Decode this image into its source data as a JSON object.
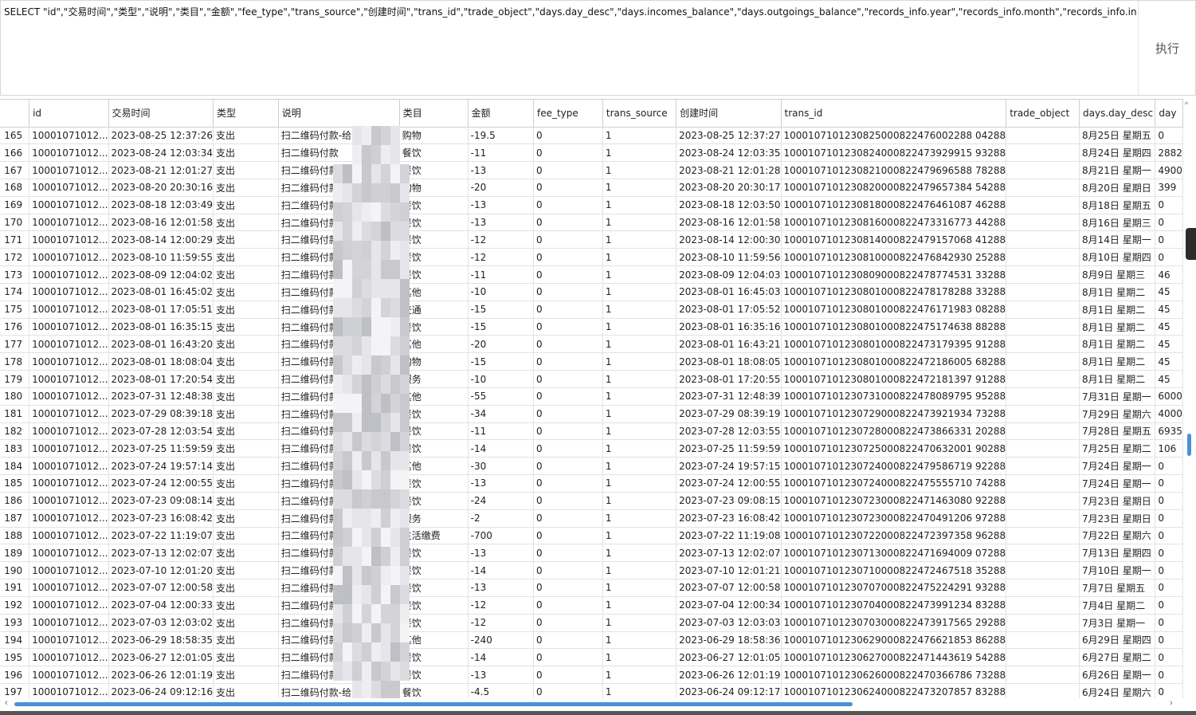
{
  "sql": {
    "query": "SELECT \"id\",\"交易时间\",\"类型\",\"说明\",\"类目\",\"金额\",\"fee_type\",\"trans_source\",\"创建时间\",\"trans_id\",\"trade_object\",\"days.day_desc\",\"days.incomes_balance\",\"days.outgoings_balance\",\"records_info.year\",\"records_info.month\",\"records_info.incomes_balance\",\"records_",
    "execute_label": "执行"
  },
  "table": {
    "columns": [
      "",
      "id",
      "交易时间",
      "类型",
      "说明",
      "类目",
      "金额",
      "fee_type",
      "trans_source",
      "创建时间",
      "trans_id",
      "trade_object",
      "days.day_desc",
      "day"
    ],
    "rows": [
      [
        "165",
        "10001071012...",
        "2023-08-25 12:37:26",
        "支出",
        "扫二维码付款-给",
        "购物",
        "-19.5",
        "0",
        "1",
        "2023-08-25 12:37:27",
        "1000107101230825000822476002288 04288",
        "",
        "8月25日 星期五",
        "0"
      ],
      [
        "166",
        "10001071012...",
        "2023-08-24 12:03:34",
        "支出",
        "扫二维码付款",
        "餐饮",
        "-11",
        "0",
        "1",
        "2023-08-24 12:03:35",
        "1000107101230824000822473929915 93288",
        "",
        "8月24日 星期四",
        "2882"
      ],
      [
        "167",
        "10001071012...",
        "2023-08-21 12:01:27",
        "支出",
        "扫二维码付款",
        "餐饮",
        "-13",
        "0",
        "1",
        "2023-08-21 12:01:28",
        "1000107101230821000822479696588 78288",
        "",
        "8月21日 星期一",
        "4900"
      ],
      [
        "168",
        "10001071012...",
        "2023-08-20 20:30:16",
        "支出",
        "扫二维码付款-给",
        "购物",
        "-20",
        "0",
        "1",
        "2023-08-20 20:30:17",
        "1000107101230820000822479657384 54288",
        "",
        "8月20日 星期日",
        "399"
      ],
      [
        "169",
        "10001071012...",
        "2023-08-18 12:03:49",
        "支出",
        "扫二维码付款-给",
        "餐饮",
        "-13",
        "0",
        "1",
        "2023-08-18 12:03:50",
        "1000107101230818000822476461087 46288",
        "",
        "8月18日 星期五",
        "0"
      ],
      [
        "170",
        "10001071012...",
        "2023-08-16 12:01:58",
        "支出",
        "扫二维码付款-",
        "餐饮",
        "-13",
        "0",
        "1",
        "2023-08-16 12:01:58",
        "1000107101230816000822473316773 44288",
        "",
        "8月16日 星期三",
        "0"
      ],
      [
        "171",
        "10001071012...",
        "2023-08-14 12:00:29",
        "支出",
        "扫二维码付款-",
        "餐饮",
        "-12",
        "0",
        "1",
        "2023-08-14 12:00:30",
        "1000107101230814000822479157068 41288",
        "",
        "8月14日 星期一",
        "0"
      ],
      [
        "172",
        "10001071012...",
        "2023-08-10 11:59:55",
        "支出",
        "扫二维码付款-",
        "餐饮",
        "-12",
        "0",
        "1",
        "2023-08-10 11:59:56",
        "1000107101230810000822476842930 25288",
        "",
        "8月10日 星期四",
        "0"
      ],
      [
        "173",
        "10001071012...",
        "2023-08-09 12:04:02",
        "支出",
        "扫二维码付款-",
        "餐饮",
        "-11",
        "0",
        "1",
        "2023-08-09 12:04:03",
        "1000107101230809000822478774531 33288",
        "",
        "8月9日 星期三",
        "46"
      ],
      [
        "174",
        "10001071012...",
        "2023-08-01 16:45:02",
        "支出",
        "扫二维码付款-给",
        "其他",
        "-10",
        "0",
        "1",
        "2023-08-01 16:45:03",
        "1000107101230801000822478178288 33288",
        "",
        "8月1日 星期二",
        "45"
      ],
      [
        "175",
        "10001071012...",
        "2023-08-01 17:05:51",
        "支出",
        "扫二维码付款-给",
        "交通",
        "-15",
        "0",
        "1",
        "2023-08-01 17:05:52",
        "1000107101230801000822476171983 08288",
        "",
        "8月1日 星期二",
        "45"
      ],
      [
        "176",
        "10001071012...",
        "2023-08-01 16:35:15",
        "支出",
        "扫二维码付款-给",
        "餐饮",
        "-15",
        "0",
        "1",
        "2023-08-01 16:35:16",
        "1000107101230801000822475174638 88288",
        "",
        "8月1日 星期二",
        "45"
      ],
      [
        "177",
        "10001071012...",
        "2023-08-01 16:43:20",
        "支出",
        "扫二维码付款-给",
        "其他",
        "-20",
        "0",
        "1",
        "2023-08-01 16:43:21",
        "1000107101230801000822473179395 91288",
        "",
        "8月1日 星期二",
        "45"
      ],
      [
        "178",
        "10001071012...",
        "2023-08-01 18:08:04",
        "支出",
        "扫二维码付款-给",
        "购物",
        "-15",
        "0",
        "1",
        "2023-08-01 18:08:05",
        "1000107101230801000822472186005 68288",
        "",
        "8月1日 星期二",
        "45"
      ],
      [
        "179",
        "10001071012...",
        "2023-08-01 17:20:54",
        "支出",
        "扫二维码付款",
        "服务",
        "-10",
        "0",
        "1",
        "2023-08-01 17:20:55",
        "1000107101230801000822472181397 91288",
        "",
        "8月1日 星期二",
        "45"
      ],
      [
        "180",
        "10001071012...",
        "2023-07-31 12:48:38",
        "支出",
        "扫二维码付款",
        "其他",
        "-55",
        "0",
        "1",
        "2023-07-31 12:48:39",
        "1000107101230731000822478089795 95288",
        "",
        "7月31日 星期一",
        "6000"
      ],
      [
        "181",
        "10001071012...",
        "2023-07-29 08:39:18",
        "支出",
        "扫二维码付款",
        "餐饮",
        "-34",
        "0",
        "1",
        "2023-07-29 08:39:19",
        "1000107101230729000822473921934 73288",
        "",
        "7月29日 星期六",
        "4000"
      ],
      [
        "182",
        "10001071012...",
        "2023-07-28 12:03:54",
        "支出",
        "扫二维码付款",
        "餐饮",
        "-11",
        "0",
        "1",
        "2023-07-28 12:03:55",
        "1000107101230728000822473866331 20288",
        "",
        "7月28日 星期五",
        "6935"
      ],
      [
        "183",
        "10001071012...",
        "2023-07-25 11:59:59",
        "支出",
        "扫二维码付款-",
        "餐饮",
        "-14",
        "0",
        "1",
        "2023-07-25 11:59:59",
        "1000107101230725000822470632001 90288",
        "",
        "7月25日 星期二",
        "106"
      ],
      [
        "184",
        "10001071012...",
        "2023-07-24 19:57:14",
        "支出",
        "扫二维码付款-",
        "其他",
        "-30",
        "0",
        "1",
        "2023-07-24 19:57:15",
        "1000107101230724000822479586719 92288",
        "",
        "7月24日 星期一",
        "0"
      ],
      [
        "185",
        "10001071012...",
        "2023-07-24 12:00:55",
        "支出",
        "扫二维码付款-",
        "餐饮",
        "-13",
        "0",
        "1",
        "2023-07-24 12:00:55",
        "1000107101230724000822475555710 74288",
        "",
        "7月24日 星期一",
        "0"
      ],
      [
        "186",
        "10001071012...",
        "2023-07-23 09:08:14",
        "支出",
        "扫二维码付款-",
        "餐饮",
        "-24",
        "0",
        "1",
        "2023-07-23 09:08:15",
        "1000107101230723000822471463080 92288",
        "",
        "7月23日 星期日",
        "0"
      ],
      [
        "187",
        "10001071012...",
        "2023-07-23 16:08:42",
        "支出",
        "扫二维码付款-",
        "服务",
        "-2",
        "0",
        "1",
        "2023-07-23 16:08:42",
        "1000107101230723000822470491206 97288",
        "",
        "7月23日 星期日",
        "0"
      ],
      [
        "188",
        "10001071012...",
        "2023-07-22 11:19:07",
        "支出",
        "扫二维码付款-",
        "生活缴费",
        "-700",
        "0",
        "1",
        "2023-07-22 11:19:08",
        "1000107101230722000822472397358 96288",
        "",
        "7月22日 星期六",
        "0"
      ],
      [
        "189",
        "10001071012...",
        "2023-07-13 12:02:07",
        "支出",
        "扫二维码付款-",
        "餐饮",
        "-13",
        "0",
        "1",
        "2023-07-13 12:02:07",
        "1000107101230713000822471694009 07288",
        "",
        "7月13日 星期四",
        "0"
      ],
      [
        "190",
        "10001071012...",
        "2023-07-10 12:01:20",
        "支出",
        "扫二维码付款-",
        "餐饮",
        "-14",
        "0",
        "1",
        "2023-07-10 12:01:21",
        "1000107101230710000822472467518 35288",
        "",
        "7月10日 星期一",
        "0"
      ],
      [
        "191",
        "10001071012...",
        "2023-07-07 12:00:58",
        "支出",
        "扫二维码付款-",
        "餐饮",
        "-13",
        "0",
        "1",
        "2023-07-07 12:00:58",
        "1000107101230707000822475224291 93288",
        "",
        "7月7日 星期五",
        "0"
      ],
      [
        "192",
        "10001071012...",
        "2023-07-04 12:00:33",
        "支出",
        "扫二维码付款-",
        "餐饮",
        "-12",
        "0",
        "1",
        "2023-07-04 12:00:34",
        "1000107101230704000822473991234 83288",
        "",
        "7月4日 星期二",
        "0"
      ],
      [
        "193",
        "10001071012...",
        "2023-07-03 12:03:02",
        "支出",
        "扫二维码付款-",
        "餐饮",
        "-12",
        "0",
        "1",
        "2023-07-03 12:03:03",
        "1000107101230703000822473917565 29288",
        "",
        "7月3日 星期一",
        "0"
      ],
      [
        "194",
        "10001071012...",
        "2023-06-29 18:58:35",
        "支出",
        "扫二维码付款-",
        "其他",
        "-240",
        "0",
        "1",
        "2023-06-29 18:58:36",
        "1000107101230629000822476621853 86288",
        "",
        "6月29日 星期四",
        "0"
      ],
      [
        "195",
        "10001071012...",
        "2023-06-27 12:01:05",
        "支出",
        "扫二维码付款-",
        "餐饮",
        "-14",
        "0",
        "1",
        "2023-06-27 12:01:05",
        "1000107101230627000822471443619 54288",
        "",
        "6月27日 星期二",
        "0"
      ],
      [
        "196",
        "10001071012...",
        "2023-06-26 12:01:19",
        "支出",
        "扫二维码付款-给",
        "餐饮",
        "-13",
        "0",
        "1",
        "2023-06-26 12:01:19",
        "1000107101230626000822470366786 73288",
        "",
        "6月26日 星期一",
        "0"
      ],
      [
        "197",
        "10001071012...",
        "2023-06-24 09:12:16",
        "支出",
        "扫二维码付款-给",
        "餐饮",
        "-4.5",
        "0",
        "1",
        "2023-06-24 09:12:17",
        "1000107101230624000822473207857 83288",
        "",
        "6月24日 星期六",
        "0"
      ]
    ]
  },
  "scroll": {
    "left_arrow": "‹",
    "right_arrow": "›",
    "up_arrow": "^"
  }
}
